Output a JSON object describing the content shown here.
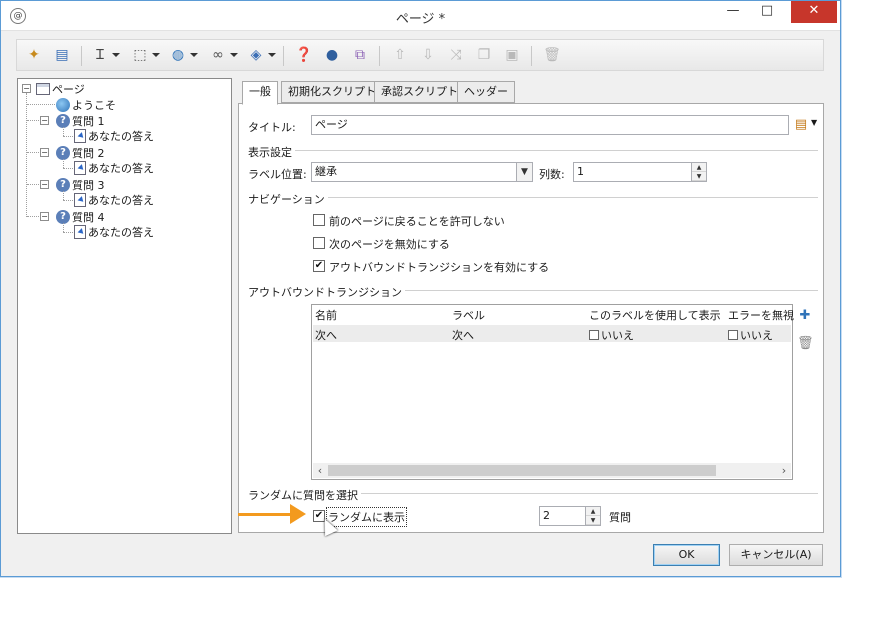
{
  "window": {
    "app_icon": "app-logo-icon",
    "title": "ページ *",
    "minimize": "—",
    "maximize": "□",
    "close": "✕"
  },
  "toolbar": {
    "icons": [
      "wand-icon",
      "database-icon",
      "text-cursor-icon",
      "selection-icon",
      "globe-icon",
      "link-icon",
      "cube-icon",
      "help-icon",
      "person-icon",
      "add-shapes-icon",
      "arrow-up-icon",
      "arrow-down-icon",
      "shuffle-icon",
      "copy-icon",
      "paste-icon",
      "delete-icon"
    ]
  },
  "tree": {
    "root": "ページ",
    "welcome": "ようこそ",
    "questions": [
      {
        "label": "質問 1",
        "answer": "あなたの答え"
      },
      {
        "label": "質問 2",
        "answer": "あなたの答え"
      },
      {
        "label": "質問 3",
        "answer": "あなたの答え"
      },
      {
        "label": "質問 4",
        "answer": "あなたの答え"
      }
    ]
  },
  "tabs": [
    "一般",
    "初期化スクリプト",
    "承認スクリプト",
    "ヘッダー"
  ],
  "form": {
    "title_label": "タイトル:",
    "title_value": "ページ",
    "display_section": "表示設定",
    "label_position_label": "ラベル位置:",
    "label_position_value": "継承",
    "columns_label": "列数:",
    "columns_value": "1",
    "nav_section": "ナビゲーション",
    "nav_options": [
      {
        "label": "前のページに戻ることを許可しない",
        "checked": false
      },
      {
        "label": "次のページを無効にする",
        "checked": false
      },
      {
        "label": "アウトバウンドトランジションを有効にする",
        "checked": true
      }
    ],
    "outbound_section": "アウトバウンドトランジション",
    "grid_headers": [
      "名前",
      "ラベル",
      "このラベルを使用して表示",
      "エラーを無視"
    ],
    "grid_rows": [
      {
        "name": "次へ",
        "label": "次へ",
        "show": "いいえ",
        "ignore": "いいえ"
      }
    ],
    "random_section": "ランダムに質問を選択",
    "random_label": "ランダムに表示",
    "random_checked": true,
    "random_count": "2",
    "random_unit": "質問"
  },
  "buttons": {
    "ok": "OK",
    "cancel": "キャンセル(A)"
  }
}
